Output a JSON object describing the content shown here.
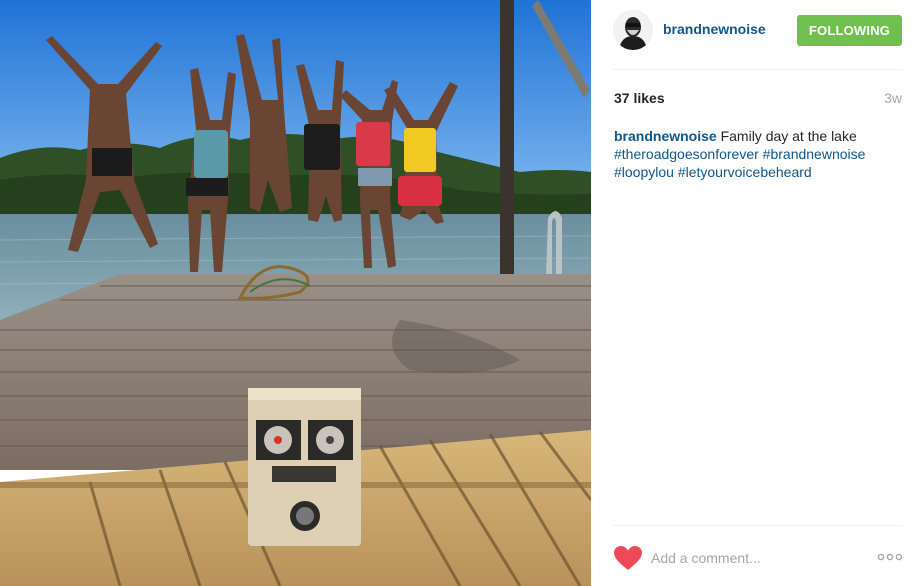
{
  "post": {
    "username": "brandnewnoise",
    "follow_label": "FOLLOWING",
    "likes": "37 likes",
    "age": "3w",
    "caption": {
      "username": "brandnewnoise",
      "text": " Family day at the lake",
      "hashtags": [
        "#theroadgoesonforever",
        "#brandnewnoise",
        "#loopylou",
        "#letyourvoicebeheard"
      ]
    }
  },
  "comment": {
    "placeholder": "Add a comment..."
  },
  "icons": {
    "like": "heart-icon",
    "more": "more-options-icon"
  },
  "colors": {
    "link": "#125688",
    "following": "#70c050",
    "heart": "#ed4956"
  }
}
